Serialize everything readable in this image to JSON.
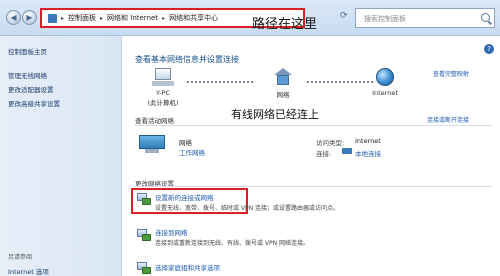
{
  "address": {
    "crumbs": [
      "控制面板",
      "网络和 Internet",
      "网络和共享中心"
    ],
    "annotation": "路径在这里",
    "search_placeholder": "搜索控制面板"
  },
  "sidebar": {
    "items": [
      {
        "label": "控制面板主页"
      },
      {
        "label": "管理无线网络"
      },
      {
        "label": "更改适配器设置"
      },
      {
        "label": "更改高级共享设置"
      }
    ],
    "see_also": "另请参阅",
    "bottom_item": "Internet 选项"
  },
  "main": {
    "title": "查看基本网络信息并设置连接",
    "view_full_map": "查看完整映射",
    "nodes": [
      {
        "name": "Y-PC",
        "sub": "(此计算机)"
      },
      {
        "name": "网络",
        "sub": ""
      },
      {
        "name": "Internet",
        "sub": ""
      }
    ],
    "wired_annotation": "有线网络已经连上",
    "active_section": "查看活动网络",
    "connect_or_disconnect": "连接或断开连接",
    "network_name": "网络",
    "network_type": "工作网络",
    "access_type_label": "访问类型:",
    "access_type_value": "Internet",
    "connection_label": "连接:",
    "connection_value": "本地连接",
    "change_section": "更改网络设置",
    "settings": [
      {
        "link": "设置新的连接或网络",
        "desc": "设置无线、宽带、拨号、临时或 VPN 连接；或设置路由器或访问点。"
      },
      {
        "link": "连接到网络",
        "desc": "连接到或重新连接到无线、有线、拨号或 VPN 网络连接。"
      },
      {
        "link": "选择家庭组和共享选项",
        "desc": ""
      }
    ]
  },
  "colors": {
    "highlight": "#d92027",
    "link": "#1e5bb0"
  }
}
